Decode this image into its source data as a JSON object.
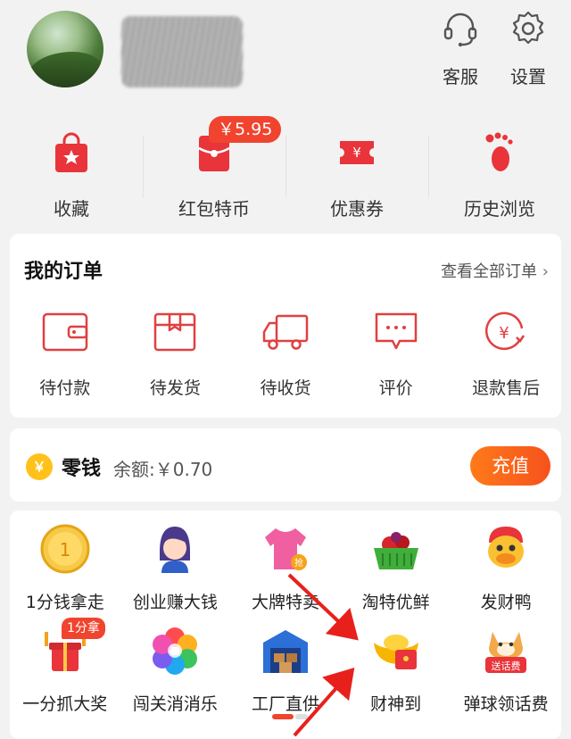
{
  "header": {
    "service_label": "客服",
    "settings_label": "设置",
    "service_icon": "headset-icon",
    "settings_icon": "gear-icon"
  },
  "quick": {
    "items": [
      {
        "label": "收藏",
        "icon": "favorite-bag-icon"
      },
      {
        "label": "红包特币",
        "icon": "red-envelope-icon",
        "badge": "￥5.95"
      },
      {
        "label": "优惠券",
        "icon": "coupon-icon"
      },
      {
        "label": "历史浏览",
        "icon": "footprint-icon"
      }
    ]
  },
  "orders": {
    "title": "我的订单",
    "view_all": "查看全部订单",
    "items": [
      {
        "label": "待付款",
        "icon": "wallet-icon"
      },
      {
        "label": "待发货",
        "icon": "package-icon"
      },
      {
        "label": "待收货",
        "icon": "truck-icon"
      },
      {
        "label": "评价",
        "icon": "comment-icon"
      },
      {
        "label": "退款售后",
        "icon": "refund-icon"
      }
    ]
  },
  "wallet": {
    "coin_symbol": "￥",
    "title": "零钱",
    "balance": "余额:￥0.70",
    "topup_label": "充值"
  },
  "grid": {
    "row1": [
      {
        "label": "1分钱拿走",
        "icon": "one-cent-coin-icon"
      },
      {
        "label": "创业赚大钱",
        "icon": "businesswoman-icon"
      },
      {
        "label": "大牌特卖",
        "icon": "tshirt-icon"
      },
      {
        "label": "淘特优鲜",
        "icon": "fruit-basket-icon"
      },
      {
        "label": "发财鸭",
        "icon": "duck-icon"
      }
    ],
    "row2": [
      {
        "label": "一分抓大奖",
        "icon": "gift-claw-icon",
        "badge": "1分拿"
      },
      {
        "label": "闯关消消乐",
        "icon": "pinwheel-icon"
      },
      {
        "label": "工厂直供",
        "icon": "factory-icon"
      },
      {
        "label": "财神到",
        "icon": "gold-ingot-icon"
      },
      {
        "label": "弹球领话费",
        "icon": "shiba-icon",
        "icon_text": "送话费"
      }
    ]
  },
  "colors": {
    "accent": "#f0442f",
    "topup": "#ff7a1a",
    "background": "#f2f2f2"
  }
}
